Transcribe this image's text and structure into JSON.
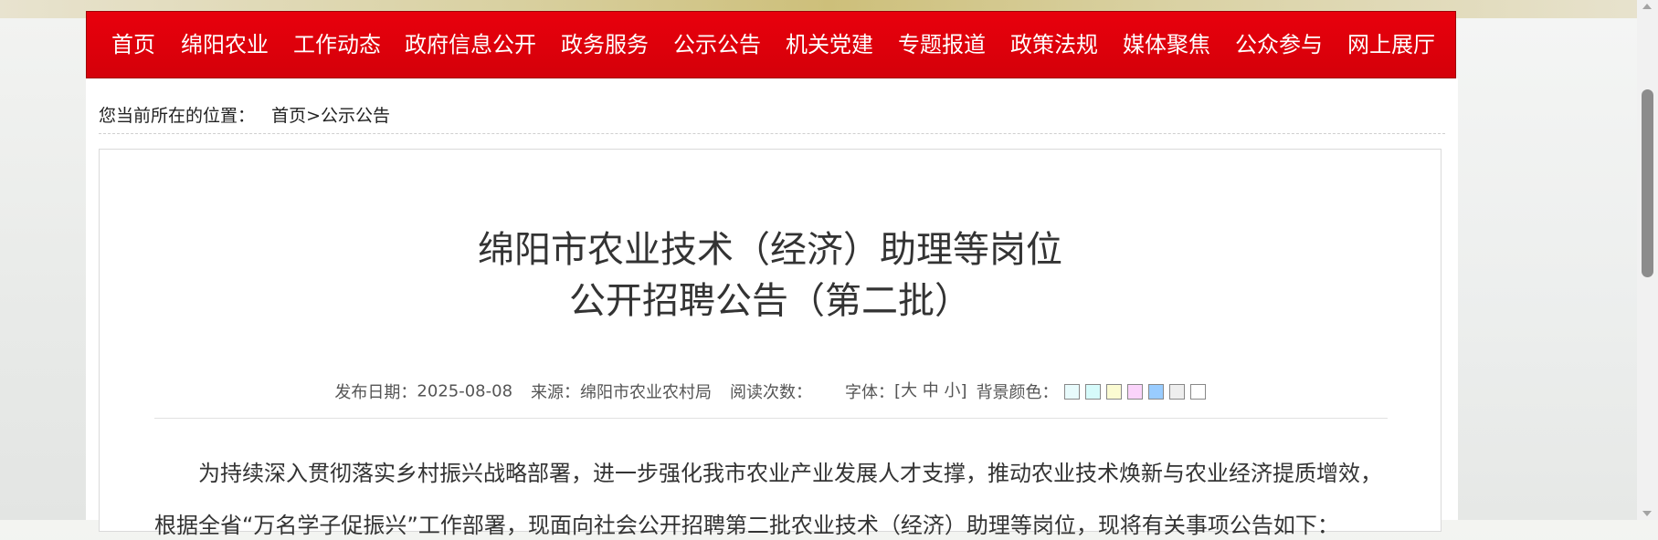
{
  "nav": {
    "items": [
      "首页",
      "绵阳农业",
      "工作动态",
      "政府信息公开",
      "政务服务",
      "公示公告",
      "机关党建",
      "专题报道",
      "政策法规",
      "媒体聚焦",
      "公众参与",
      "网上展厅"
    ]
  },
  "breadcrumb": {
    "prefix": "您当前所在的位置：",
    "home": "首页",
    "separator": ">",
    "current": "公示公告"
  },
  "article": {
    "title_line1": "绵阳市农业技术（经济）助理等岗位",
    "title_line2": "公开招聘公告（第二批）",
    "meta": {
      "date_label": "发布日期：",
      "date_value": "2025-08-08",
      "source_label": "来源：",
      "source_value": "绵阳市农业农村局",
      "views_label": "阅读次数：",
      "font_label": "字体：",
      "font_open": "[",
      "font_large": "大",
      "font_medium": "中",
      "font_small": "小",
      "font_close": "]",
      "bgcolor_label": "背景颜色："
    },
    "bg_swatches": [
      "#e8fbfc",
      "#d6fbfb",
      "#fbfbd2",
      "#fbd4fb",
      "#99ccff",
      "#eeeeee",
      "#ffffff"
    ],
    "paragraph1": "为持续深入贯彻落实乡村振兴战略部署，进一步强化我市农业产业发展人才支撑，推动农业技术焕新与农业经济提质增效，",
    "paragraph2": "根据全省“万名学子促振兴”工作部署，现面向社会公开招聘第二批农业技术（经济）助理等岗位，现将有关事项公告如下："
  },
  "colors": {
    "nav_bg": "#e0000b",
    "nav_text": "#ffffff"
  }
}
